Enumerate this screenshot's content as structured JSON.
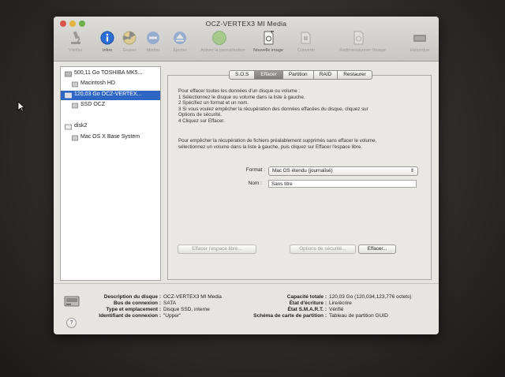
{
  "window": {
    "title": "OCZ-VERTEX3 MI Media"
  },
  "toolbar": {
    "items": [
      {
        "label": "Vérifier",
        "icon": "microscope-icon",
        "enabled": false
      },
      {
        "label": "Infos",
        "icon": "info-icon",
        "enabled": true
      },
      {
        "label": "Graver",
        "icon": "burn-icon",
        "enabled": false
      },
      {
        "label": "Monter",
        "icon": "mount-icon",
        "enabled": false
      },
      {
        "label": "Éjecter",
        "icon": "eject-icon",
        "enabled": false
      },
      {
        "label": "Activer la journalisation",
        "icon": "journal-icon",
        "enabled": false
      },
      {
        "label": "Nouvelle image",
        "icon": "new-image-icon",
        "enabled": true
      },
      {
        "label": "Convertir",
        "icon": "convert-icon",
        "enabled": false
      },
      {
        "label": "Redimensionner l'image",
        "icon": "resize-image-icon",
        "enabled": false
      },
      {
        "label": "Historique",
        "icon": "log-icon",
        "enabled": false
      }
    ]
  },
  "sidebar": {
    "items": [
      {
        "label": "500,11 Go TOSHIBA MK5...",
        "kind": "disk"
      },
      {
        "label": "Macintosh HD",
        "kind": "volume"
      },
      {
        "label": "120,03 Go OCZ-VERTEX...",
        "kind": "disk",
        "selected": true
      },
      {
        "label": "SSD OCZ",
        "kind": "volume"
      },
      {
        "label": "disk2",
        "kind": "disk"
      },
      {
        "label": "Mac OS X Base System",
        "kind": "volume"
      }
    ]
  },
  "tabs": [
    {
      "label": "S.O.S",
      "active": false
    },
    {
      "label": "Effacer",
      "active": true
    },
    {
      "label": "Partition",
      "active": false
    },
    {
      "label": "RAID",
      "active": false
    },
    {
      "label": "Restaurer",
      "active": false
    }
  ],
  "erase": {
    "instructions1": [
      "Pour effacer toutes les données d'un disque ou volume :",
      "1  Sélectionnez le disque ou volume dans la liste à gauche.",
      "2  Spécifiez un format et un nom.",
      "3  Si vous voulez empêcher la récupération des données effacées du disque, cliquez sur",
      "     Options de sécurité.",
      "4  Cliquez sur Effacer."
    ],
    "instructions2": [
      "Pour empêcher la récupération de fichiers préalablement supprimés sans effacer le volume,",
      "sélectionnez un volume dans la liste à gauche, puis cliquez sur Effacer l'espace libre."
    ],
    "format_label": "Format :",
    "format_value": "Mac OS étendu (journalisé)",
    "name_label": "Nom :",
    "name_value": "Sans titre",
    "btn_free_space": "Effacer l'espace libre...",
    "btn_security": "Options de sécurité...",
    "btn_erase": "Effacer..."
  },
  "info": {
    "left": [
      {
        "k": "Description du disque :",
        "v": "OCZ-VERTEX3 MI Media"
      },
      {
        "k": "Bus de connexion :",
        "v": "SATA"
      },
      {
        "k": "Type et emplacement :",
        "v": "Disque SSD, interne"
      },
      {
        "k": "Identifiant de connexion :",
        "v": "\"Upper\""
      }
    ],
    "right": [
      {
        "k": "Capacité totale :",
        "v": "120,03 Go (120,034,123,776 octets)"
      },
      {
        "k": "État d'écriture :",
        "v": "Lire/écrire"
      },
      {
        "k": "État S.M.A.R.T. :",
        "v": "Vérifié"
      },
      {
        "k": "Schéma de carte de partition :",
        "v": "Tableau de partition GUID"
      }
    ],
    "help": "?"
  }
}
